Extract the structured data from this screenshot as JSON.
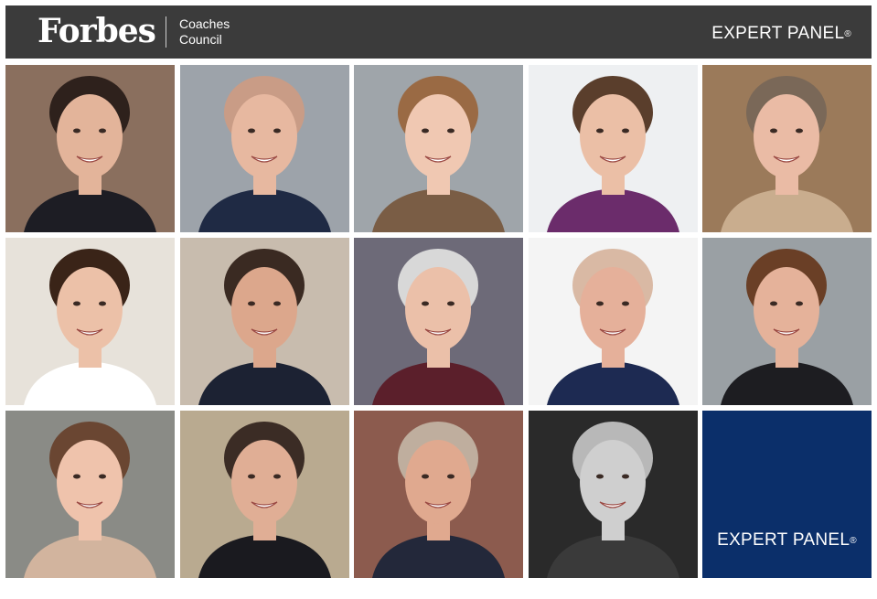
{
  "header": {
    "logo_text": "Forbes",
    "council_line1": "Coaches",
    "council_line2": "Council",
    "expert_label": "EXPERT PANEL",
    "registered_mark": "®",
    "background": "#3b3b3b"
  },
  "portraits": [
    {
      "bg": "#8a6f5e",
      "skin": "#e3b49a",
      "hair": "#2e211c",
      "shirt": "#1d1d24"
    },
    {
      "bg": "#9da3aa",
      "skin": "#e7b8a0",
      "hair": "#c99c86",
      "shirt": "#1f2a44"
    },
    {
      "bg": "#9fa5aa",
      "skin": "#f0c8b2",
      "hair": "#9a6a44",
      "shirt": "#7a5d45"
    },
    {
      "bg": "#eef0f2",
      "skin": "#ebbfa6",
      "hair": "#5a3e2c",
      "shirt": "#6b2c6b"
    },
    {
      "bg": "#9b7a5a",
      "skin": "#eabba5",
      "hair": "#7a6858",
      "shirt": "#c9ad8e"
    },
    {
      "bg": "#e7e2da",
      "skin": "#ecc1a8",
      "hair": "#3a2418",
      "shirt": "#ffffff"
    },
    {
      "bg": "#c8bcae",
      "skin": "#dca78c",
      "hair": "#3a2a22",
      "shirt": "#1c2233"
    },
    {
      "bg": "#6d6a78",
      "skin": "#ebc0a9",
      "hair": "#d8d8d8",
      "shirt": "#5b1f2b"
    },
    {
      "bg": "#f4f4f4",
      "skin": "#e5b09a",
      "hair": "#d9b9a4",
      "shirt": "#1d2a52"
    },
    {
      "bg": "#9aa0a4",
      "skin": "#e5b29a",
      "hair": "#6a3f26",
      "shirt": "#1d1d21"
    },
    {
      "bg": "#8a8b86",
      "skin": "#efc3ac",
      "hair": "#6a4632",
      "shirt": "#d2b49e"
    },
    {
      "bg": "#b9aa90",
      "skin": "#e0ae95",
      "hair": "#3b2c25",
      "shirt": "#1a1a1f"
    },
    {
      "bg": "#8c5b4e",
      "skin": "#e0a98f",
      "hair": "#bfae9e",
      "shirt": "#23283a"
    },
    {
      "bg": "#2a2a2a",
      "skin": "#cfcfcf",
      "hair": "#b8b8b8",
      "shirt": "#3a3a3a"
    }
  ],
  "badge": {
    "label": "EXPERT PANEL",
    "registered_mark": "®",
    "background": "#0b2f6a"
  }
}
